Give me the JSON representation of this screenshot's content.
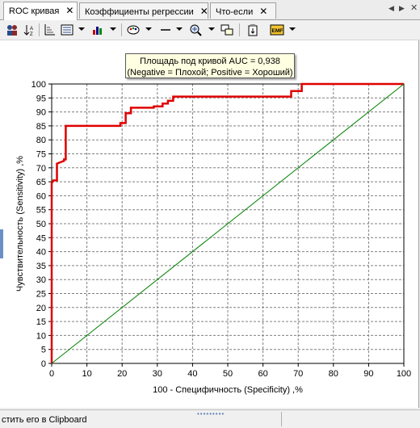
{
  "tabs": [
    {
      "label": "ROC кривая",
      "active": true
    },
    {
      "label": "Коэффициенты регрессии",
      "active": false
    },
    {
      "label": "Что-если",
      "active": false
    }
  ],
  "toolbar": {
    "icons": [
      "users-icon",
      "sort-icon",
      "axis-icon",
      "list-icon",
      "bar-chart-icon",
      "palette-icon",
      "line-style-icon",
      "zoom-icon",
      "windows-icon",
      "clipboard-icon",
      "emf-icon"
    ]
  },
  "auc_box": {
    "line1": "Площадь под кривой AUC = 0,938",
    "line2": "(Negative = Плохой; Positive = Хороший)"
  },
  "status": {
    "text": "стить его в Clipboard"
  },
  "colors": {
    "roc_curve": "#e00000",
    "diagonal": "#008000",
    "grid": "#808080"
  },
  "chart_data": {
    "type": "line",
    "xlabel": "100 - Специфичность (Specificity) ,%",
    "ylabel": "Чувствительность (Sensitivity) ,%",
    "xlim": [
      0,
      100
    ],
    "ylim": [
      0,
      100
    ],
    "x_ticks": [
      0,
      10,
      20,
      30,
      40,
      50,
      60,
      70,
      80,
      90,
      100
    ],
    "y_ticks": [
      0,
      5,
      10,
      15,
      20,
      25,
      30,
      35,
      40,
      45,
      50,
      55,
      60,
      65,
      70,
      75,
      80,
      85,
      90,
      95,
      100
    ],
    "grid": true,
    "series": [
      {
        "role": "roc_curve",
        "x": [
          0,
          0,
          0.5,
          1.5,
          1.5,
          3.5,
          3.5,
          4,
          4,
          19.5,
          19.5,
          21,
          21,
          22.5,
          22.5,
          29,
          29,
          31.5,
          31.5,
          33,
          33,
          34.5,
          34.5,
          68,
          68,
          71,
          71,
          100
        ],
        "y": [
          0,
          64.5,
          65.5,
          65.5,
          71.5,
          72.5,
          73,
          73,
          85,
          85,
          86,
          86,
          89.5,
          89.5,
          91.5,
          91.5,
          92,
          92,
          93,
          93,
          94,
          94,
          95.5,
          95.5,
          97.5,
          97.5,
          100,
          100
        ]
      },
      {
        "role": "diagonal",
        "x": [
          0,
          100
        ],
        "y": [
          0,
          100
        ]
      }
    ]
  }
}
